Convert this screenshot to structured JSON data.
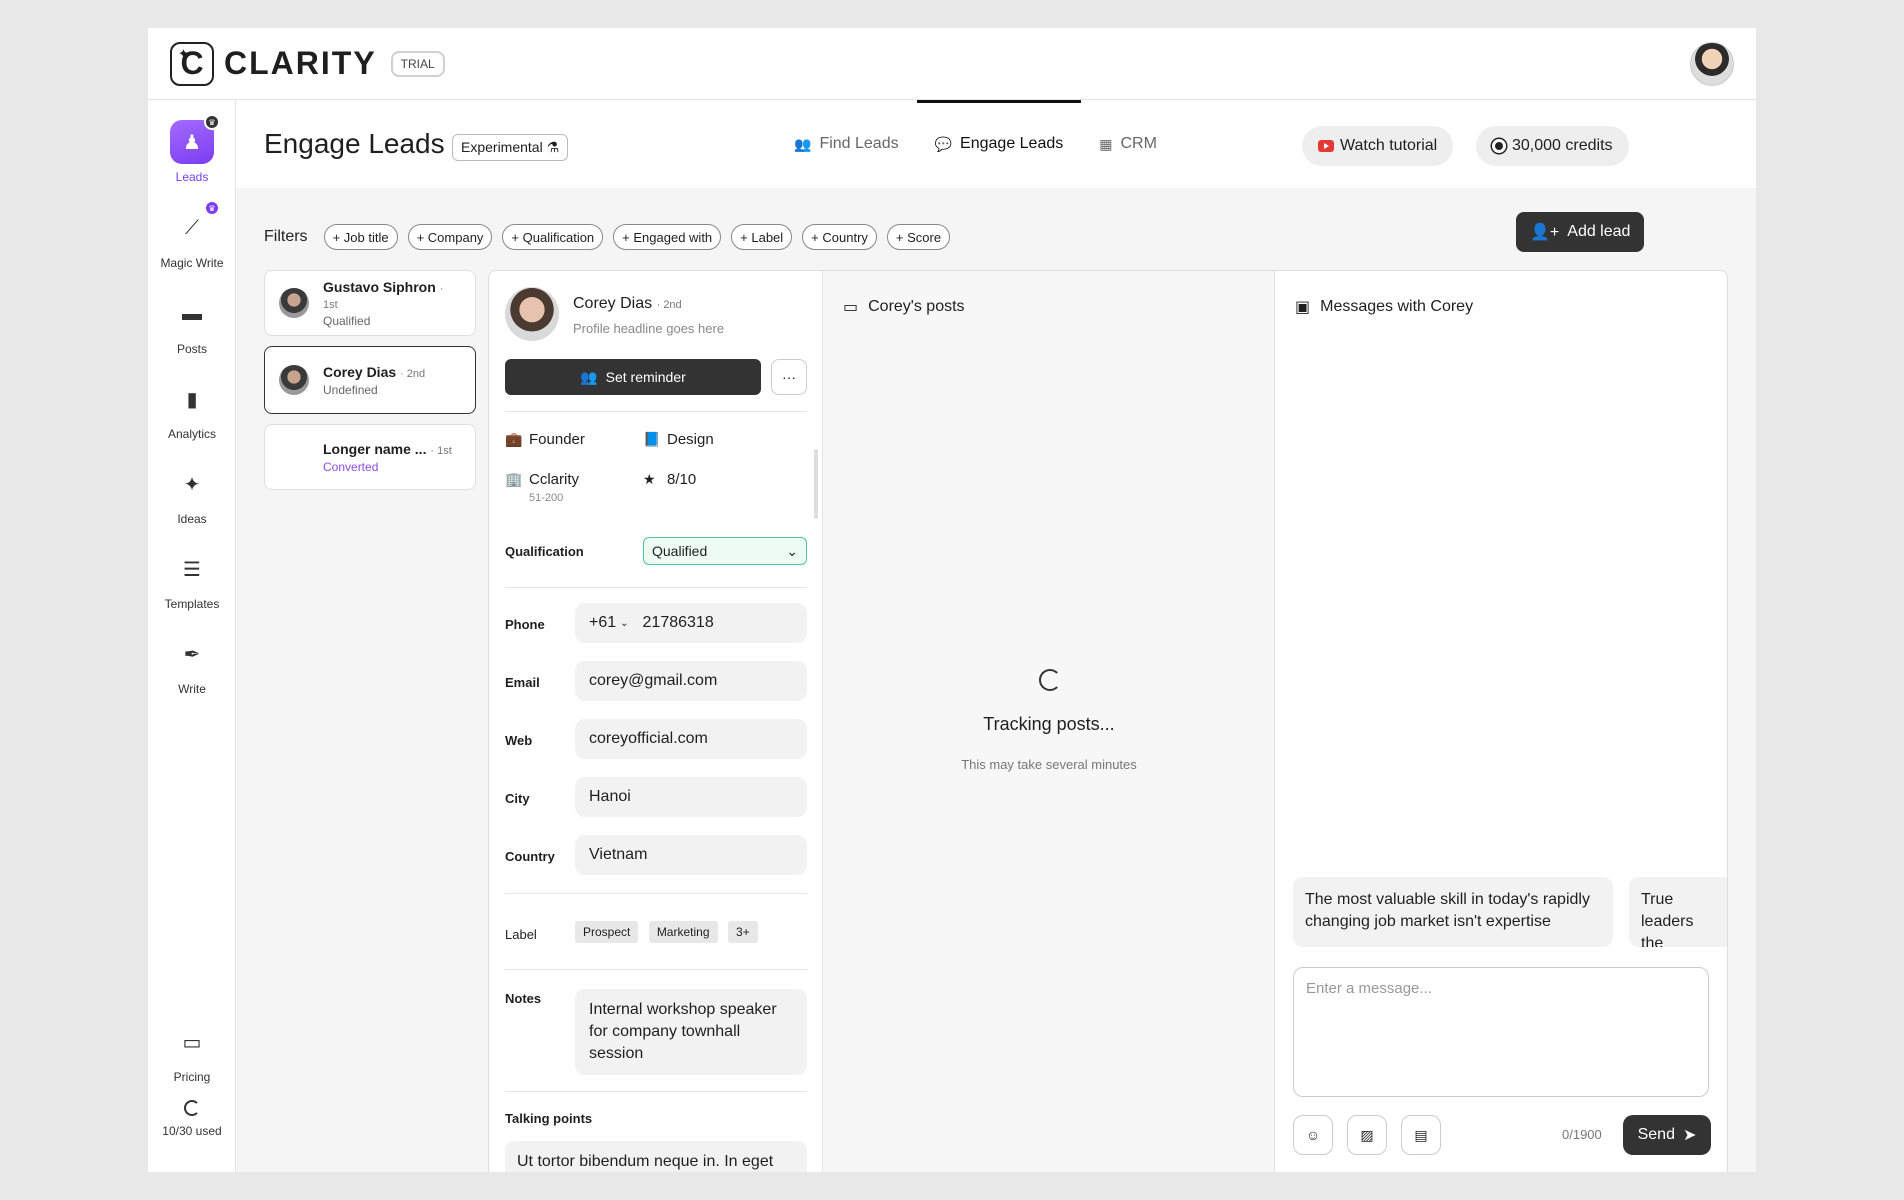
{
  "app": {
    "logo_letter": "C",
    "name": "CLARITY",
    "badge": "TRIAL"
  },
  "sidebar": {
    "items": [
      {
        "label": "Leads",
        "icon": "user-crown-icon"
      },
      {
        "label": "Magic Write",
        "icon": "magic-wand-icon"
      },
      {
        "label": "Posts",
        "icon": "post-icon"
      },
      {
        "label": "Analytics",
        "icon": "bar-chart-icon"
      },
      {
        "label": "Ideas",
        "icon": "sparkle-icon"
      },
      {
        "label": "Templates",
        "icon": "stack-icon"
      },
      {
        "label": "Write",
        "icon": "pen-icon"
      }
    ],
    "pricing_label": "Pricing",
    "usage": "10/30 used"
  },
  "header": {
    "title": "Engage Leads",
    "badge": "Experimental",
    "tabs": [
      {
        "label": "Find Leads",
        "icon": "people-icon"
      },
      {
        "label": "Engage Leads",
        "icon": "chat-icon"
      },
      {
        "label": "CRM",
        "icon": "table-icon"
      }
    ],
    "watch_tutorial": "Watch tutorial",
    "credits": "30,000 credits"
  },
  "filters": {
    "label": "Filters",
    "chips": [
      "+ Job title",
      "+ Company",
      "+ Qualification",
      "+ Engaged with",
      "+ Label",
      "+ Country",
      "+ Score"
    ],
    "add_lead": "Add lead"
  },
  "leads": [
    {
      "name": "Gustavo Siphron",
      "degree": "· 1st",
      "status": "Qualified"
    },
    {
      "name": "Corey Dias",
      "degree": "· 2nd",
      "status": "Undefined"
    },
    {
      "name": "Longer name ...",
      "degree": "· 1st",
      "status": "Converted"
    }
  ],
  "detail": {
    "name": "Corey Dias",
    "degree": "· 2nd",
    "headline": "Profile headline goes here",
    "reminder": "Set reminder",
    "more": "···",
    "role": "Founder",
    "department": "Design",
    "company": "Cclarity",
    "company_size": "51-200",
    "score": "8/10",
    "qualification_label": "Qualification",
    "qualification_value": "Qualified",
    "phone_label": "Phone",
    "phone_code": "+61",
    "phone_number": "21786318",
    "email_label": "Email",
    "email": "corey@gmail.com",
    "web_label": "Web",
    "web": "coreyofficial.com",
    "city_label": "City",
    "city": "Hanoi",
    "country_label": "Country",
    "country": "Vietnam",
    "label_label": "Label",
    "labels": [
      "Prospect",
      "Marketing",
      "3+"
    ],
    "notes_label": "Notes",
    "notes": "Internal workshop speaker for company townhall session",
    "talking_label": "Talking points",
    "talking": "Ut tortor bibendum neque in. In eget"
  },
  "posts": {
    "title": "Corey's posts",
    "tracking": "Tracking posts...",
    "tracking_sub": "This may take several minutes"
  },
  "messages": {
    "title": "Messages with Corey",
    "suggestions": [
      "The most valuable skill in today's rapidly changing job market isn't expertise",
      "True leaders the answers"
    ],
    "placeholder": "Enter a message...",
    "counter": "0/1900",
    "send": "Send"
  }
}
